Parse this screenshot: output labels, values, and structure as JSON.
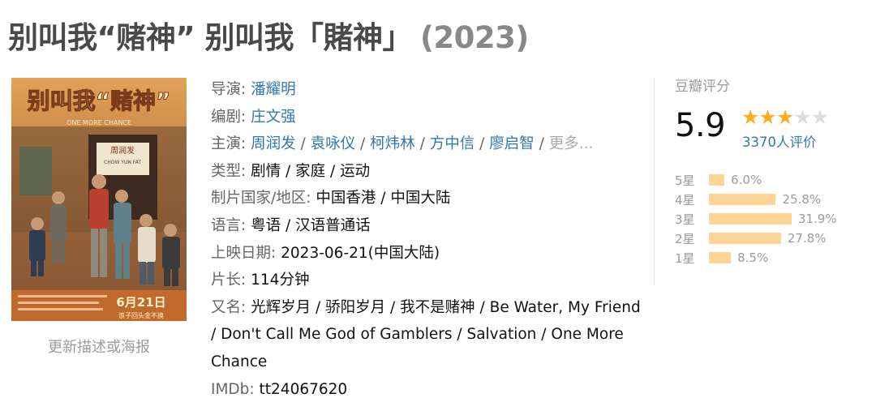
{
  "title": {
    "main": "别叫我“赌神” 别叫我「賭神」",
    "year": "(2023)"
  },
  "poster": {
    "title_art": "别叫我“赌神”",
    "subtitle_art": "ONE MORE CHANCE",
    "sign_cn": "周润发",
    "sign_en": "CHOW YUN FAT",
    "date_art": "6月21日",
    "tagline_art": "浪子回头金不换",
    "update_link": "更新描述或海报"
  },
  "info": {
    "director": {
      "label": "导演",
      "names": [
        "潘耀明"
      ]
    },
    "writer": {
      "label": "编剧",
      "names": [
        "庄文强"
      ]
    },
    "cast": {
      "label": "主演",
      "names": [
        "周润发",
        "袁咏仪",
        "柯炜林",
        "方中信",
        "廖启智"
      ],
      "more": "更多..."
    },
    "genre": {
      "label": "类型",
      "value": "剧情 / 家庭 / 运动"
    },
    "region": {
      "label": "制片国家/地区",
      "value": "中国香港 / 中国大陆"
    },
    "language": {
      "label": "语言",
      "value": "粤语 / 汉语普通话"
    },
    "release": {
      "label": "上映日期",
      "value": "2023-06-21(中国大陆)"
    },
    "runtime": {
      "label": "片长",
      "value": "114分钟"
    },
    "aka": {
      "label": "又名",
      "value": "光辉岁月 / 骄阳岁月 / 我不是赌神 / Be Water, My Friend / Don't Call Me God of Gamblers / Salvation / One More Chance"
    },
    "imdb": {
      "label": "IMDb",
      "value": "tt24067620"
    }
  },
  "rating": {
    "label": "豆瓣评分",
    "score": "5.9",
    "stars": 3,
    "votes": "3370人评价",
    "accent_color": "#ffad20",
    "bar_color": "#ffd596",
    "breakdown": [
      {
        "label": "5星",
        "percent": "6.0%",
        "value": 6.0
      },
      {
        "label": "4星",
        "percent": "25.8%",
        "value": 25.8
      },
      {
        "label": "3星",
        "percent": "31.9%",
        "value": 31.9
      },
      {
        "label": "2星",
        "percent": "27.8%",
        "value": 27.8
      },
      {
        "label": "1星",
        "percent": "8.5%",
        "value": 8.5
      }
    ]
  }
}
